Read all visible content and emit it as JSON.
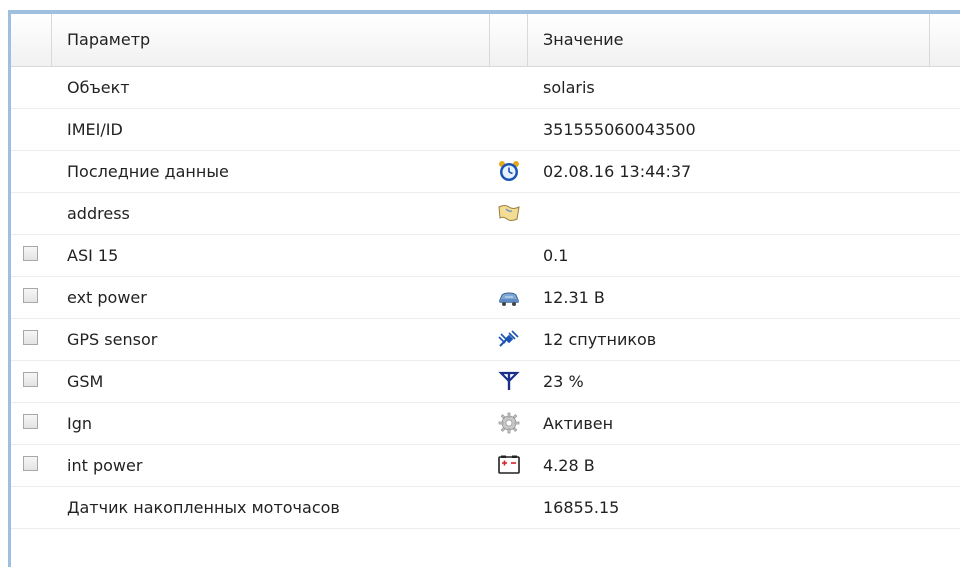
{
  "header": {
    "param_label": "Параметр",
    "value_label": "Значение"
  },
  "rows": [
    {
      "param": "Объект",
      "value": "solaris",
      "icon": "",
      "checkbox": false
    },
    {
      "param": "IMEI/ID",
      "value": "351555060043500",
      "icon": "",
      "checkbox": false
    },
    {
      "param": "Последние данные",
      "value": "02.08.16 13:44:37",
      "icon": "alarm-clock-icon",
      "checkbox": false
    },
    {
      "param": "address",
      "value": "",
      "icon": "map-icon",
      "checkbox": false
    },
    {
      "param": "ASI 15",
      "value": "0.1",
      "icon": "",
      "checkbox": true
    },
    {
      "param": "ext power",
      "value": "12.31 В",
      "icon": "car-power-icon",
      "checkbox": true
    },
    {
      "param": "GPS sensor",
      "value": "12 спутников",
      "icon": "satellite-icon",
      "checkbox": true
    },
    {
      "param": "GSM",
      "value": "23 %",
      "icon": "antenna-icon",
      "checkbox": true
    },
    {
      "param": "Ign",
      "value": "Активен",
      "icon": "gear-icon",
      "checkbox": true
    },
    {
      "param": "int power",
      "value": "4.28 В",
      "icon": "battery-icon",
      "checkbox": true
    },
    {
      "param": "Датчик накопленных моточасов",
      "value": "16855.15",
      "icon": "",
      "checkbox": false
    }
  ],
  "colors": {
    "frame_blue": "#9fbfdf",
    "icon_blue": "#1a55b5",
    "battery_red": "#d81f2a"
  }
}
